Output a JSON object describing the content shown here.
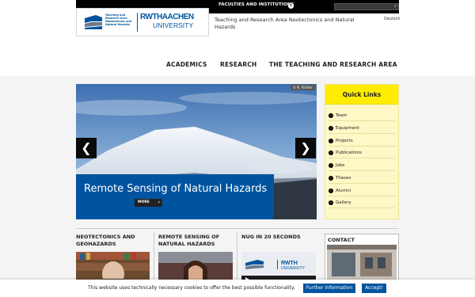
{
  "topbar": {
    "faculties_label": "FACULTIES AND INSTITUTIONS",
    "search_placeholder": ""
  },
  "logo": {
    "institute_lines": "Teaching and Research Area Neotectonics and Natural Hazards",
    "rwth": "RWTHAACHEN",
    "university": "UNIVERSITY"
  },
  "header": {
    "site_title": "Teaching and Research Area Neotectonics and Natural Hazards",
    "language": "Deutsch"
  },
  "main_nav": [
    "ACADEMICS",
    "RESEARCH",
    "THE TEACHING AND RESEARCH AREA"
  ],
  "slider": {
    "copyright": "© N. Richter",
    "caption": "Remote Sensing of Natural Hazards",
    "more_label": "MORE",
    "prev_symbol": "❮",
    "next_symbol": "❯"
  },
  "quick_links": {
    "title": "Quick Links",
    "items": [
      "Team",
      "Equipment",
      "Projects",
      "Publications",
      "Jobs",
      "Theses",
      "Alumni",
      "Gallery"
    ]
  },
  "teasers": [
    {
      "title": "NEOTECTONICS AND GEOHAZARDS"
    },
    {
      "title": "REMOTE SENSING OF NATURAL HAZARDS"
    },
    {
      "title": "NUG IN 20 SECONDS"
    }
  ],
  "contact": {
    "title": "CONTACT"
  },
  "cookie": {
    "text": "This website uses technically necessary cookies to offer the best possible functionality.",
    "info_label": "Further Information",
    "accept_label": "Accept!"
  },
  "colors": {
    "rwth_blue": "#00549f",
    "quick_links_yellow": "#ffed00",
    "topbar": "#000000"
  }
}
